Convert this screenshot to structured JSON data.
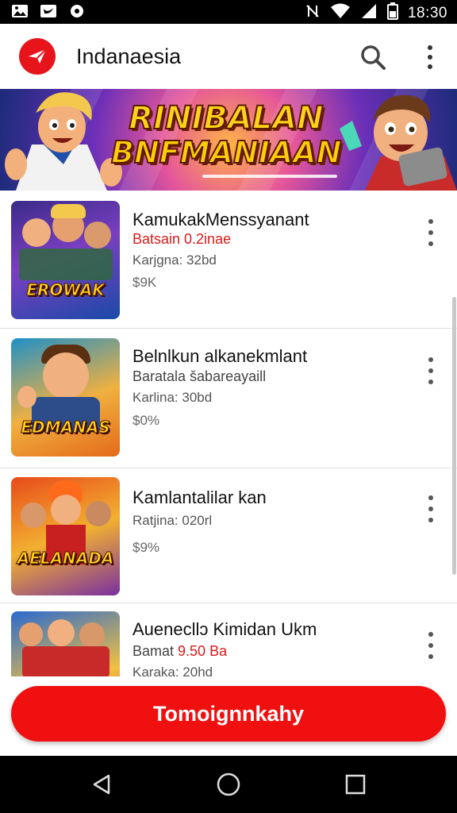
{
  "status_bar": {
    "time": "18:30",
    "icons": [
      "gallery-icon",
      "twitter-icon",
      "settings-icon",
      "nfc-icon",
      "wifi-icon",
      "signal-icon",
      "battery-icon"
    ]
  },
  "app_bar": {
    "title": "Indanaesia",
    "logo_icon": "paper-plane-icon",
    "search_icon": "search-icon",
    "menu_icon": "more-vert-icon"
  },
  "banner": {
    "line1": "RINIBALAN",
    "line2": "BNFMANIAAN"
  },
  "items": [
    {
      "title": "KamukakMenssyanant",
      "subtitle": "Batsain  0.2inae",
      "subtitle_color": "red",
      "meta": "Karjgna: 32bd",
      "price": "$9K",
      "thumb_text": "EROWAK"
    },
    {
      "title": "Belnlkun alkanekmlant",
      "subtitle": "Baratala šabareayaill",
      "subtitle_color": "dark",
      "meta": "Karlina: 30bd",
      "price": "$0%",
      "thumb_text": "EDMANAS"
    },
    {
      "title": "Kamlantalilar kan",
      "subtitle": "",
      "subtitle_color": "dark",
      "meta": "Ratjina: 020rl",
      "price": "$9%",
      "thumb_text": "AELANADA"
    },
    {
      "title": "Auenecllɔ Kimidan Ukm",
      "subtitle": "Bamat  9.50 Ba",
      "subtitle_color": "mixed",
      "meta": "Karaka: 20hd",
      "price": "",
      "thumb_text": ""
    }
  ],
  "cta": {
    "label": "Tomoignnkahy"
  },
  "nav_bar": {
    "back_icon": "back-triangle-icon",
    "home_icon": "home-circle-icon",
    "recents_icon": "recents-square-icon"
  },
  "colors": {
    "accent": "#f01010",
    "status_bar": "#000000",
    "nav_bar": "#000000"
  }
}
